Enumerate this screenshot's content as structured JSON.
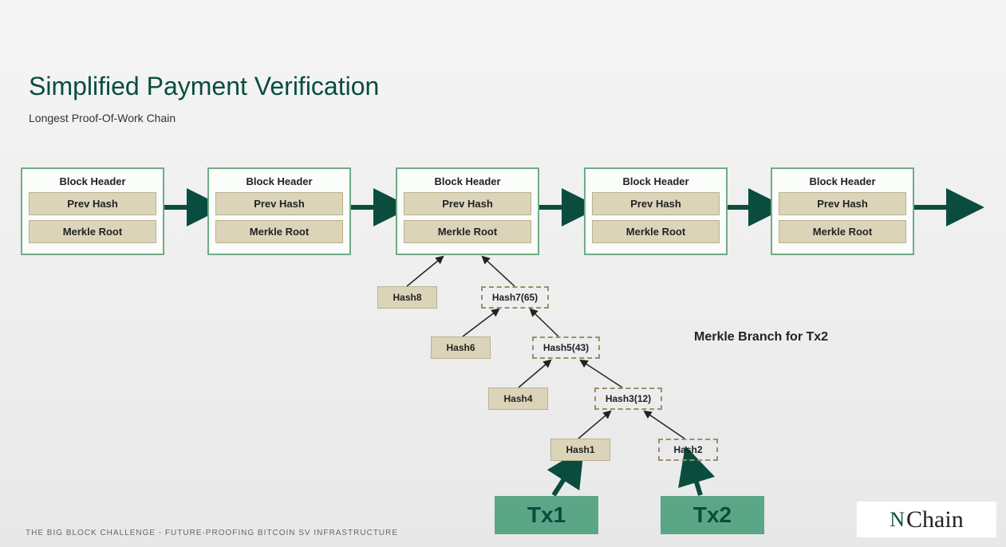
{
  "title": "Simplified Payment Verification",
  "subtitle": "Longest Proof-Of-Work Chain",
  "footer": "THE BIG BLOCK CHALLENGE - Future-proofing Bitcoin SV Infrastructure",
  "blockHeaders": [
    {
      "title": "Block Header",
      "prev": "Prev Hash",
      "root": "Merkle Root"
    },
    {
      "title": "Block Header",
      "prev": "Prev Hash",
      "root": "Merkle Root"
    },
    {
      "title": "Block Header",
      "prev": "Prev Hash",
      "root": "Merkle Root"
    },
    {
      "title": "Block Header",
      "prev": "Prev Hash",
      "root": "Merkle Root"
    },
    {
      "title": "Block Header",
      "prev": "Prev Hash",
      "root": "Merkle Root"
    }
  ],
  "hashes": {
    "h8": "Hash8",
    "h7": "Hash7(65)",
    "h6": "Hash6",
    "h5": "Hash5(43)",
    "h4": "Hash4",
    "h3": "Hash3(12)",
    "h1": "Hash1",
    "h2": "Hash2"
  },
  "tx": {
    "tx1": "Tx1",
    "tx2": "Tx2"
  },
  "merkleBranchLabel": "Merkle Branch for Tx2",
  "logo": {
    "prefix": "N",
    "main": "Chain"
  }
}
